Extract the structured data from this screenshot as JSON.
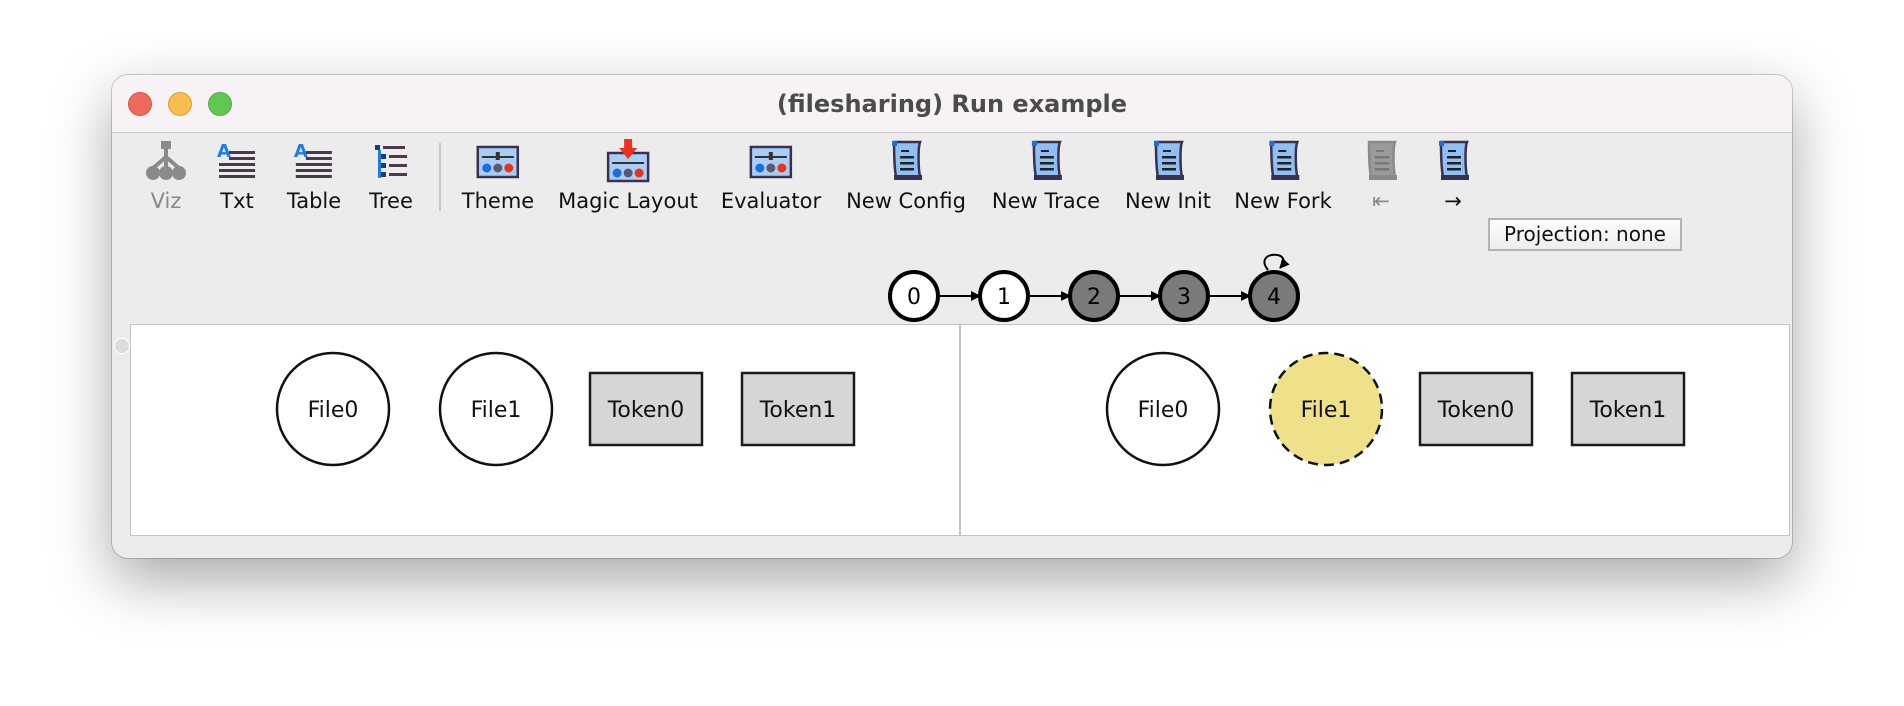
{
  "window": {
    "title": "(filesharing) Run example"
  },
  "toolbar": {
    "buttons": [
      {
        "id": "viz",
        "label": "Viz",
        "icon": "graph-tree-icon",
        "enabled": false
      },
      {
        "id": "txt",
        "label": "Txt",
        "icon": "text-lines-icon",
        "enabled": true
      },
      {
        "id": "table",
        "label": "Table",
        "icon": "text-lines-icon",
        "enabled": true
      },
      {
        "id": "tree",
        "label": "Tree",
        "icon": "tree-list-icon",
        "enabled": true
      },
      {
        "id": "theme",
        "label": "Theme",
        "icon": "slider-panel-icon",
        "enabled": true
      },
      {
        "id": "magic-layout",
        "label": "Magic Layout",
        "icon": "slider-panel-arrow-icon",
        "enabled": true
      },
      {
        "id": "evaluator",
        "label": "Evaluator",
        "icon": "slider-panel-icon",
        "enabled": true
      },
      {
        "id": "new-config",
        "label": "New Config",
        "icon": "scroll-icon",
        "enabled": true
      },
      {
        "id": "new-trace",
        "label": "New Trace",
        "icon": "scroll-icon",
        "enabled": true
      },
      {
        "id": "new-init",
        "label": "New Init",
        "icon": "scroll-icon",
        "enabled": true
      },
      {
        "id": "new-fork",
        "label": "New Fork",
        "icon": "scroll-icon",
        "enabled": true
      },
      {
        "id": "back",
        "label": "⇤",
        "icon": "scroll-icon",
        "enabled": false
      },
      {
        "id": "forward",
        "label": "→",
        "icon": "scroll-icon",
        "enabled": true
      }
    ],
    "projection": "Projection: none"
  },
  "trace": {
    "states": [
      {
        "label": "0",
        "visited": false
      },
      {
        "label": "1",
        "visited": false
      },
      {
        "label": "2",
        "visited": true
      },
      {
        "label": "3",
        "visited": true
      },
      {
        "label": "4",
        "visited": true
      }
    ],
    "self_loop_on": "4",
    "colors": {
      "visited": "#7a7a7a",
      "unvisited": "#ffffff"
    }
  },
  "panels": {
    "left": {
      "atoms": [
        {
          "label": "File0",
          "shape": "circle",
          "style": "normal"
        },
        {
          "label": "File1",
          "shape": "circle",
          "style": "normal"
        },
        {
          "label": "Token0",
          "shape": "box",
          "style": "normal"
        },
        {
          "label": "Token1",
          "shape": "box",
          "style": "normal"
        }
      ]
    },
    "right": {
      "atoms": [
        {
          "label": "File0",
          "shape": "circle",
          "style": "normal"
        },
        {
          "label": "File1",
          "shape": "circle",
          "style": "highlighted"
        },
        {
          "label": "Token0",
          "shape": "box",
          "style": "normal"
        },
        {
          "label": "Token1",
          "shape": "box",
          "style": "normal"
        }
      ]
    },
    "colors": {
      "highlight": "#efe08a",
      "box_fill": "#d6d6d6"
    }
  }
}
